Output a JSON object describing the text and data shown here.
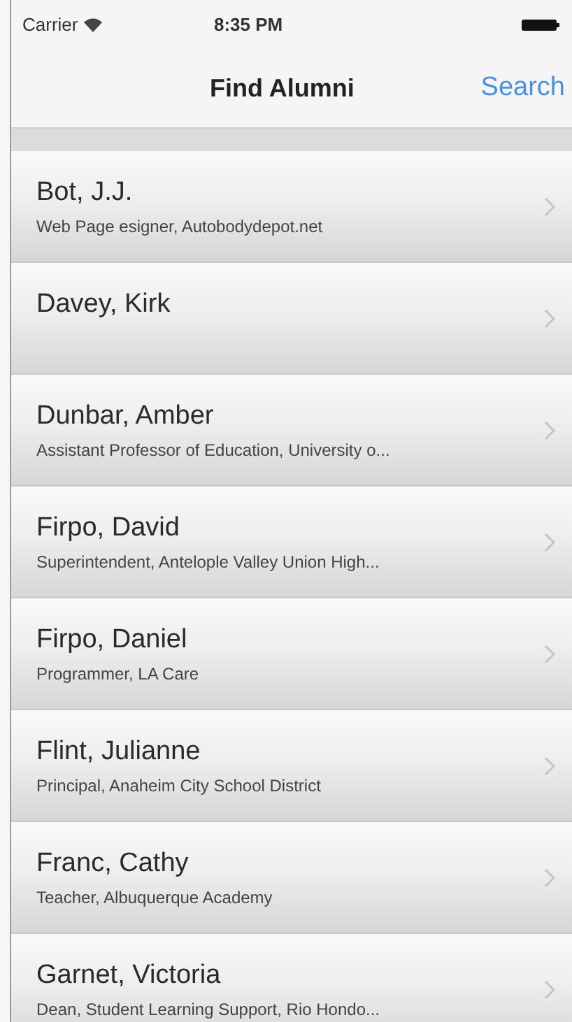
{
  "status_bar": {
    "carrier": "Carrier",
    "time": "8:35 PM"
  },
  "nav_bar": {
    "title": "Find Alumni",
    "action": "Search"
  },
  "alumni": [
    {
      "name": "Bot, J.J.",
      "subtitle": "Web Page esigner, Autobodydepot.net"
    },
    {
      "name": "Davey, Kirk"
    },
    {
      "name": "Dunbar, Amber",
      "subtitle": "Assistant Professor of Education, University o..."
    },
    {
      "name": "Firpo, David",
      "subtitle": "Superintendent, Antelople Valley Union High..."
    },
    {
      "name": "Firpo, Daniel",
      "subtitle": "Programmer, LA Care"
    },
    {
      "name": "Flint, Julianne",
      "subtitle": "Principal, Anaheim City School District"
    },
    {
      "name": "Franc, Cathy",
      "subtitle": "Teacher, Albuquerque Academy"
    },
    {
      "name": "Garnet, Victoria",
      "subtitle": "Dean, Student Learning Support, Rio Hondo..."
    }
  ]
}
